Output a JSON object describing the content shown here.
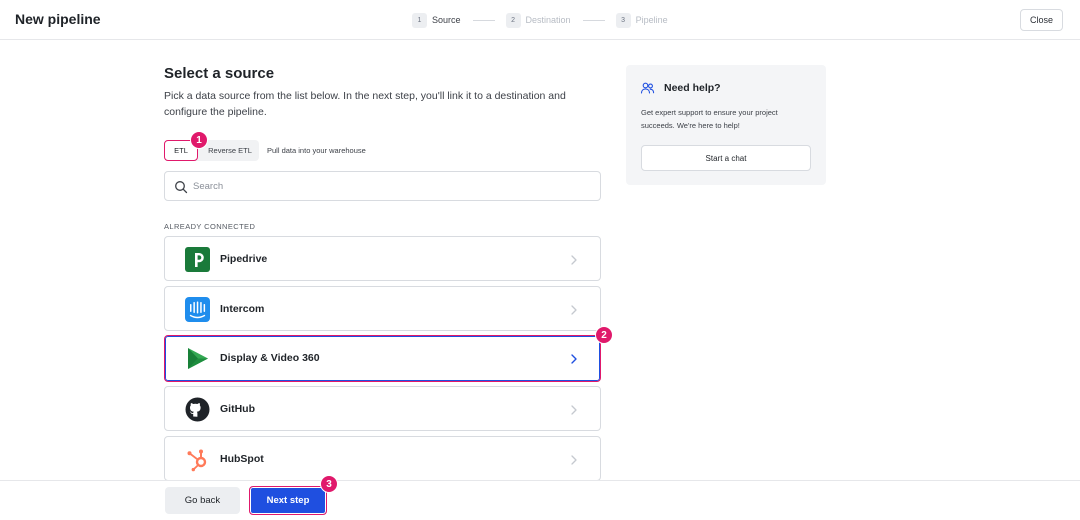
{
  "header": {
    "title": "New pipeline",
    "steps": [
      {
        "number": "1",
        "label": "Source",
        "active": true
      },
      {
        "number": "2",
        "label": "Destination",
        "active": false
      },
      {
        "number": "3",
        "label": "Pipeline",
        "active": false
      }
    ],
    "close_label": "Close"
  },
  "main": {
    "heading": "Select a source",
    "description": "Pick a data source from the list below. In the next step, you'll link it to a destination and configure the pipeline.",
    "tabs": [
      {
        "label": "ETL",
        "selected": true
      },
      {
        "label": "Reverse ETL",
        "selected": false
      }
    ],
    "tab_hint": "Pull data into your warehouse",
    "search": {
      "placeholder": "Search",
      "value": ""
    },
    "section_label": "ALREADY CONNECTED",
    "sources": [
      {
        "name": "Pipedrive",
        "icon": "pipedrive-logo-icon"
      },
      {
        "name": "Intercom",
        "icon": "intercom-logo-icon"
      },
      {
        "name": "Display & Video 360",
        "icon": "display-video-360-logo-icon",
        "selected": true
      },
      {
        "name": "GitHub",
        "icon": "github-logo-icon"
      },
      {
        "name": "HubSpot",
        "icon": "hubspot-logo-icon"
      }
    ]
  },
  "help": {
    "title": "Need help?",
    "text": "Get expert support to ensure your project succeeds. We're here to help!",
    "chat_label": "Start a chat"
  },
  "footer": {
    "back_label": "Go back",
    "next_label": "Next step"
  },
  "annotations": [
    "1",
    "2",
    "3"
  ],
  "colors": {
    "accent_blue": "#1f4fe0",
    "highlight_pink": "#e0196b",
    "pipedrive_green": "#1a7a3a",
    "intercom_blue": "#1f8ded",
    "hubspot_orange": "#ff7a59"
  }
}
